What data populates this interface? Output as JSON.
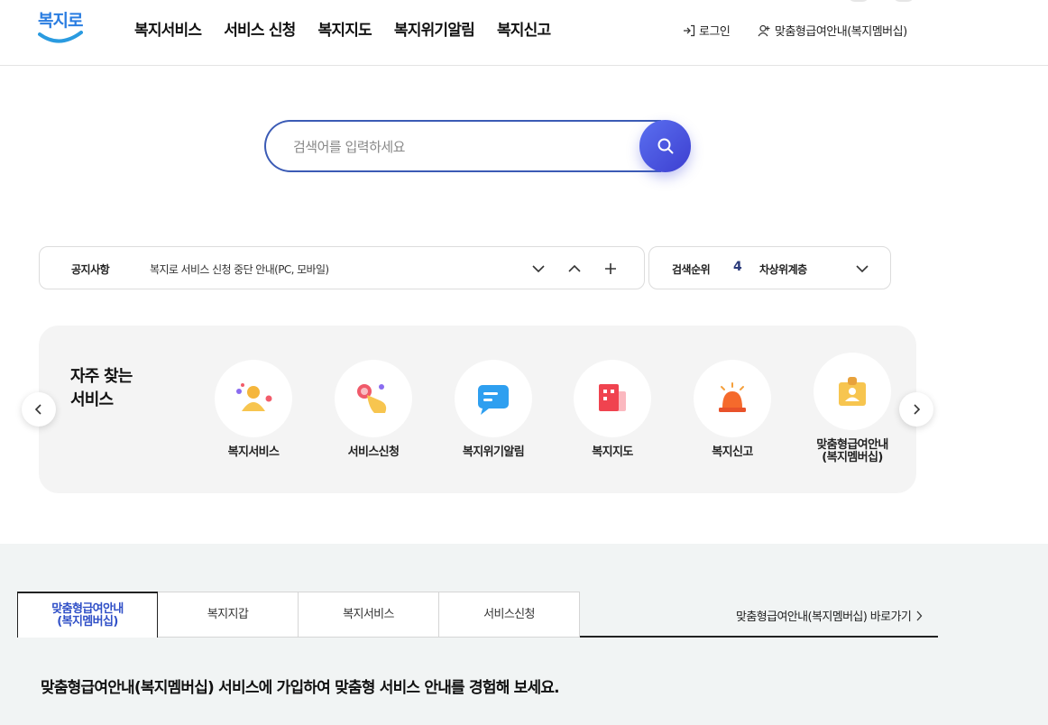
{
  "header": {
    "logo_text": "복지로",
    "gnb": [
      "복지서비스",
      "서비스 신청",
      "복지지도",
      "복지위기알림",
      "복지신고"
    ],
    "login_label": "로그인",
    "membership_label": "맞춤형급여안내(복지멤버십)"
  },
  "search": {
    "placeholder": "검색어를 입력하세요"
  },
  "notice": {
    "label": "공지사항",
    "text": "복지로 서비스 신청 중단 안내(PC, 모바일)"
  },
  "rank": {
    "label": "검색순위",
    "number": "4",
    "term": "차상위계층"
  },
  "favorites": {
    "title_line1": "자주 찾는",
    "title_line2": "서비스",
    "items": [
      {
        "label": "복지서비스",
        "icon": "people-icon"
      },
      {
        "label": "서비스신청",
        "icon": "hand-tap-icon"
      },
      {
        "label": "복지위기알림",
        "icon": "message-icon"
      },
      {
        "label": "복지지도",
        "icon": "building-icon"
      },
      {
        "label": "복지신고",
        "icon": "siren-icon"
      },
      {
        "label": "맞춤형급여안내\n(복지멤버십)",
        "icon": "id-badge-icon"
      }
    ]
  },
  "bottom": {
    "tabs": [
      "맞춤형급여안내\n(복지멤버십)",
      "복지지갑",
      "복지서비스",
      "서비스신청"
    ],
    "goto_label": "맞춤형급여안내(복지멤버십) 바로가기",
    "description": "맞춤형급여안내(복지멤버십) 서비스에 가입하여 맞춤형 서비스 안내를 경험해 보세요."
  },
  "colors": {
    "brand_blue": "#2a7de1",
    "search_border": "#3b5bb5",
    "search_button": "#4a55e0",
    "active_tab_text": "#2f4fc7"
  }
}
